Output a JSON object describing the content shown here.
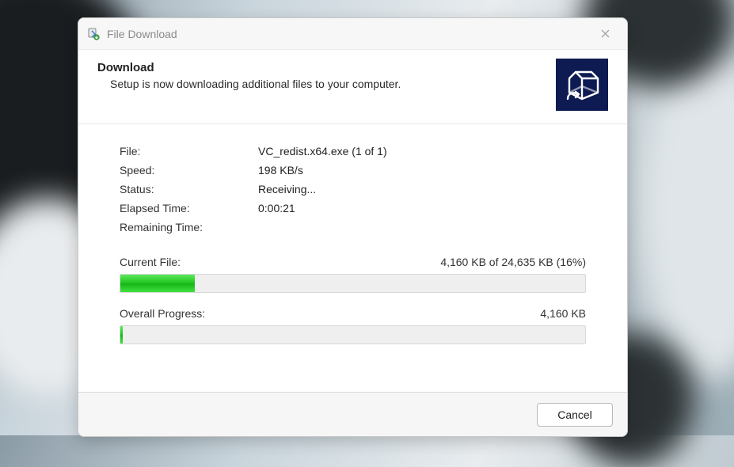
{
  "window": {
    "title": "File Download"
  },
  "header": {
    "title": "Download",
    "subtitle": "Setup is now downloading additional files to your computer."
  },
  "info": {
    "labels": {
      "file": "File:",
      "speed": "Speed:",
      "status": "Status:",
      "elapsed": "Elapsed Time:",
      "remaining": "Remaining Time:"
    },
    "values": {
      "file": "VC_redist.x64.exe (1 of 1)",
      "speed": "198 KB/s",
      "status": "Receiving...",
      "elapsed": "0:00:21",
      "remaining": ""
    }
  },
  "progress": {
    "current": {
      "label": "Current File:",
      "detail": "4,160 KB of 24,635 KB (16%)",
      "percent": 16
    },
    "overall": {
      "label": "Overall Progress:",
      "detail": "4,160 KB",
      "percent": 0.5
    }
  },
  "footer": {
    "cancel_label": "Cancel"
  }
}
